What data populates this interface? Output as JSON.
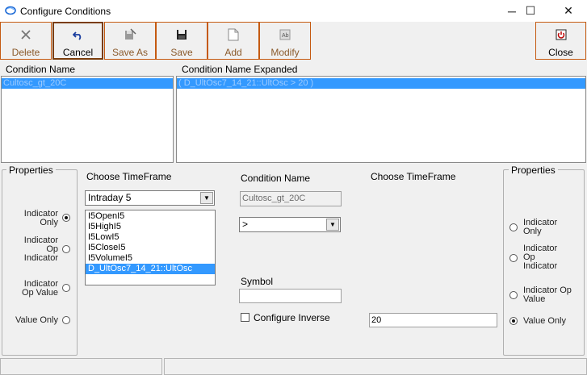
{
  "window": {
    "title": "Configure Conditions",
    "minimize_glyph": "─",
    "maximize_glyph": "☐",
    "close_glyph": "✕"
  },
  "toolbar": {
    "delete_label": "Delete",
    "cancel_label": "Cancel",
    "save_as_label": "Save As",
    "save_label": "Save",
    "add_label": "Add",
    "modify_label": "Modify",
    "close_label": "Close"
  },
  "grid": {
    "col_condition_name": "Condition Name",
    "col_condition_expanded": "Condition Name Expanded",
    "selected_name": "Cultosc_gt_20C",
    "selected_expanded": "( D_UltOsc7_14_21::UltOsc > 20 )"
  },
  "left_properties": {
    "title": "Properties",
    "options": [
      {
        "label": "Indicator Only",
        "selected": true
      },
      {
        "label": "Indicator Op Indicator",
        "selected": false
      },
      {
        "label": "Indicator Op Value",
        "selected": false
      },
      {
        "label": "Value Only",
        "selected": false
      }
    ]
  },
  "left_timeframe": {
    "label": "Choose TimeFrame",
    "selected": "Intraday 5",
    "items": [
      "I5OpenI5",
      "I5HighI5",
      "I5LowI5",
      "I5CloseI5",
      "I5VolumeI5",
      "D_UltOsc7_14_21::UltOsc"
    ],
    "selected_item_index": 5
  },
  "middle": {
    "condition_name_label": "Condition Name",
    "condition_name_value": "Cultosc_gt_20C",
    "operator_value": ">",
    "symbol_label": "Symbol",
    "symbol_value": "",
    "configure_inverse_label": "Configure Inverse",
    "configure_inverse_checked": false
  },
  "right_timeframe": {
    "label": "Choose TimeFrame",
    "value_input": "20"
  },
  "right_properties": {
    "title": "Properties",
    "options": [
      {
        "label": "Indicator Only",
        "selected": false
      },
      {
        "label": "Indicator Op Indicator",
        "selected": false
      },
      {
        "label": "Indicator Op Value",
        "selected": false
      },
      {
        "label": "Value Only",
        "selected": true
      }
    ]
  },
  "colors": {
    "accent_border": "#c55a11",
    "selection": "#3399ff"
  },
  "icons": {
    "delete": "x-icon",
    "cancel": "undo-icon",
    "save_as": "save-as-icon",
    "save": "floppy-icon",
    "add": "new-document-icon",
    "modify": "edit-document-icon",
    "close": "power-icon"
  }
}
